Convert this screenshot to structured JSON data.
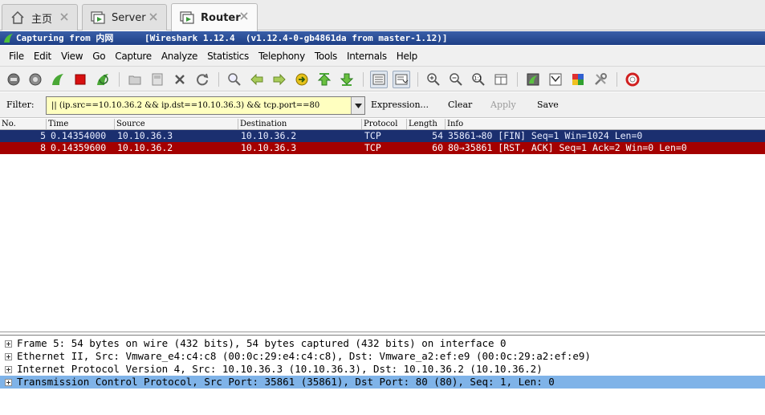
{
  "vm_tabs": [
    {
      "label": "主页",
      "icon": "home-icon"
    },
    {
      "label": "Server",
      "icon": "vm-icon"
    },
    {
      "label": "Router",
      "icon": "vm-icon"
    }
  ],
  "title": {
    "capturing": "Capturing from 内网",
    "version": "[Wireshark 1.12.4  (v1.12.4-0-gb4861da from master-1.12)]"
  },
  "menu": [
    "File",
    "Edit",
    "View",
    "Go",
    "Capture",
    "Analyze",
    "Statistics",
    "Telephony",
    "Tools",
    "Internals",
    "Help"
  ],
  "toolbar_icons": [
    "interface-list-icon",
    "capture-options-icon",
    "start-capture-icon",
    "stop-capture-icon",
    "restart-capture-icon",
    "open-file-icon",
    "save-file-icon",
    "close-file-icon",
    "reload-icon",
    "find-packet-icon",
    "go-back-icon",
    "go-forward-icon",
    "go-to-packet-icon",
    "go-first-icon",
    "go-last-icon",
    "colorize-icon",
    "autoscroll-icon",
    "zoom-in-icon",
    "zoom-out-icon",
    "zoom-normal-icon",
    "resize-columns-icon",
    "capture-filters-icon",
    "display-filters-icon",
    "coloring-rules-icon",
    "preferences-icon",
    "help-icon"
  ],
  "filter": {
    "label": "Filter:",
    "value": "|| (ip.src==10.10.36.2 && ip.dst==10.10.36.3) && tcp.port==80",
    "expression": "Expression...",
    "clear": "Clear",
    "apply": "Apply",
    "save": "Save"
  },
  "packet_list": {
    "columns": [
      "No.",
      "Time",
      "Source",
      "Destination",
      "Protocol",
      "Length",
      "Info"
    ],
    "rows": [
      {
        "no": "5",
        "time": "0.14354000",
        "source": "10.10.36.3",
        "destination": "10.10.36.2",
        "protocol": "TCP",
        "length": "54",
        "info": "35861→80 [FIN] Seq=1 Win=1024 Len=0",
        "bg": "#1b2f6f",
        "fg": "#e8edff"
      },
      {
        "no": "8",
        "time": "0.14359600",
        "source": "10.10.36.2",
        "destination": "10.10.36.3",
        "protocol": "TCP",
        "length": "60",
        "info": "80→35861 [RST, ACK] Seq=1 Ack=2 Win=0 Len=0",
        "bg": "#a40000",
        "fg": "#ffffff"
      }
    ]
  },
  "details": [
    {
      "text": "Frame 5: 54 bytes on wire (432 bits), 54 bytes captured (432 bits) on interface 0",
      "selected": false
    },
    {
      "text": "Ethernet II, Src: Vmware_e4:c4:c8 (00:0c:29:e4:c4:c8), Dst: Vmware_a2:ef:e9 (00:0c:29:a2:ef:e9)",
      "selected": false
    },
    {
      "text": "Internet Protocol Version 4, Src: 10.10.36.3 (10.10.36.3), Dst: 10.10.36.2 (10.10.36.2)",
      "selected": false
    },
    {
      "text": "Transmission Control Protocol, Src Port: 35861 (35861), Dst Port: 80 (80), Seq: 1, Len: 0",
      "selected": true
    }
  ],
  "colors": {
    "title_bar": "#1e3f86",
    "selected_row": "#1b2f6f",
    "rst_row": "#a40000",
    "filter_bg": "#ffffc0",
    "detail_selected": "#7fb3e8"
  }
}
